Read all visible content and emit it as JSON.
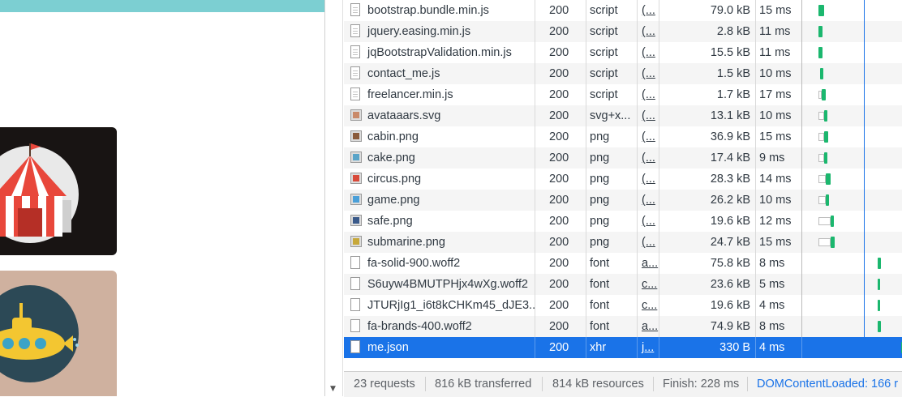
{
  "network": {
    "rows": [
      {
        "name": "bootstrap.bundle.min.js",
        "status": "200",
        "type": "script",
        "initiator": "(...",
        "size": "79.0 kB",
        "time": "15 ms",
        "icon": "script-file-icon",
        "wf_wait": 0.0,
        "wf_recv": 0.06
      },
      {
        "name": "jquery.easing.min.js",
        "status": "200",
        "type": "script",
        "initiator": "(...",
        "size": "2.8 kB",
        "time": "11 ms",
        "icon": "script-file-icon",
        "wf_wait": 0.0,
        "wf_recv": 0.04
      },
      {
        "name": "jqBootstrapValidation.min.js",
        "status": "200",
        "type": "script",
        "initiator": "(...",
        "size": "15.5 kB",
        "time": "11 ms",
        "icon": "script-file-icon",
        "wf_wait": 0.0,
        "wf_recv": 0.04
      },
      {
        "name": "contact_me.js",
        "status": "200",
        "type": "script",
        "initiator": "(...",
        "size": "1.5 kB",
        "time": "10 ms",
        "icon": "script-file-icon",
        "wf_wait": 0.02,
        "wf_recv": 0.03
      },
      {
        "name": "freelancer.min.js",
        "status": "200",
        "type": "script",
        "initiator": "(...",
        "size": "1.7 kB",
        "time": "17 ms",
        "icon": "script-file-icon",
        "wf_wait": 0.03,
        "wf_recv": 0.04
      },
      {
        "name": "avataaars.svg",
        "status": "200",
        "type": "svg+x...",
        "initiator": "(...",
        "size": "13.1 kB",
        "time": "10 ms",
        "icon": "avatar-image-icon",
        "wf_wait": 0.06,
        "wf_recv": 0.03
      },
      {
        "name": "cabin.png",
        "status": "200",
        "type": "png",
        "initiator": "(...",
        "size": "36.9 kB",
        "time": "15 ms",
        "icon": "cabin-image-icon",
        "wf_wait": 0.06,
        "wf_recv": 0.04
      },
      {
        "name": "cake.png",
        "status": "200",
        "type": "png",
        "initiator": "(...",
        "size": "17.4 kB",
        "time": "9 ms",
        "icon": "cake-image-icon",
        "wf_wait": 0.06,
        "wf_recv": 0.03
      },
      {
        "name": "circus.png",
        "status": "200",
        "type": "png",
        "initiator": "(...",
        "size": "28.3 kB",
        "time": "14 ms",
        "icon": "circus-image-icon",
        "wf_wait": 0.07,
        "wf_recv": 0.05
      },
      {
        "name": "game.png",
        "status": "200",
        "type": "png",
        "initiator": "(...",
        "size": "26.2 kB",
        "time": "10 ms",
        "icon": "game-image-icon",
        "wf_wait": 0.07,
        "wf_recv": 0.03
      },
      {
        "name": "safe.png",
        "status": "200",
        "type": "png",
        "initiator": "(...",
        "size": "19.6 kB",
        "time": "12 ms",
        "icon": "safe-image-icon",
        "wf_wait": 0.12,
        "wf_recv": 0.03
      },
      {
        "name": "submarine.png",
        "status": "200",
        "type": "png",
        "initiator": "(...",
        "size": "24.7 kB",
        "time": "15 ms",
        "icon": "submarine-image-icon",
        "wf_wait": 0.12,
        "wf_recv": 0.04
      },
      {
        "name": "fa-solid-900.woff2",
        "status": "200",
        "type": "font",
        "initiator": "a...",
        "size": "75.8 kB",
        "time": "8 ms",
        "icon": "font-file-icon",
        "wf_wait": 0.59,
        "wf_recv": 0.03
      },
      {
        "name": "S6uyw4BMUTPHjx4wXg.woff2",
        "status": "200",
        "type": "font",
        "initiator": "c...",
        "size": "23.6 kB",
        "time": "5 ms",
        "icon": "font-file-icon",
        "wf_wait": 0.59,
        "wf_recv": 0.02
      },
      {
        "name": "JTURjIg1_i6t8kCHKm45_dJE3...",
        "status": "200",
        "type": "font",
        "initiator": "c...",
        "size": "19.6 kB",
        "time": "4 ms",
        "icon": "font-file-icon",
        "wf_wait": 0.59,
        "wf_recv": 0.02
      },
      {
        "name": "fa-brands-400.woff2",
        "status": "200",
        "type": "font",
        "initiator": "a...",
        "size": "74.9 kB",
        "time": "8 ms",
        "icon": "font-file-icon",
        "wf_wait": 0.59,
        "wf_recv": 0.03
      },
      {
        "name": "me.json",
        "status": "200",
        "type": "xhr",
        "initiator": "j...",
        "size": "330 B",
        "time": "4 ms",
        "icon": "json-file-icon",
        "wf_wait": 0.82,
        "wf_recv": 0.02
      }
    ],
    "selected_row": "me.json"
  },
  "footer": {
    "requests": "23 requests",
    "transferred": "816 kB transferred",
    "resources": "814 kB resources",
    "finish": "Finish: 228 ms",
    "dom_content_loaded": "DOMContentLoaded: 166 r"
  },
  "colors": {
    "selected_row": "#1a73e8",
    "waterfall_receive": "#1bb76e",
    "teal_header": "#7ccfd2"
  }
}
